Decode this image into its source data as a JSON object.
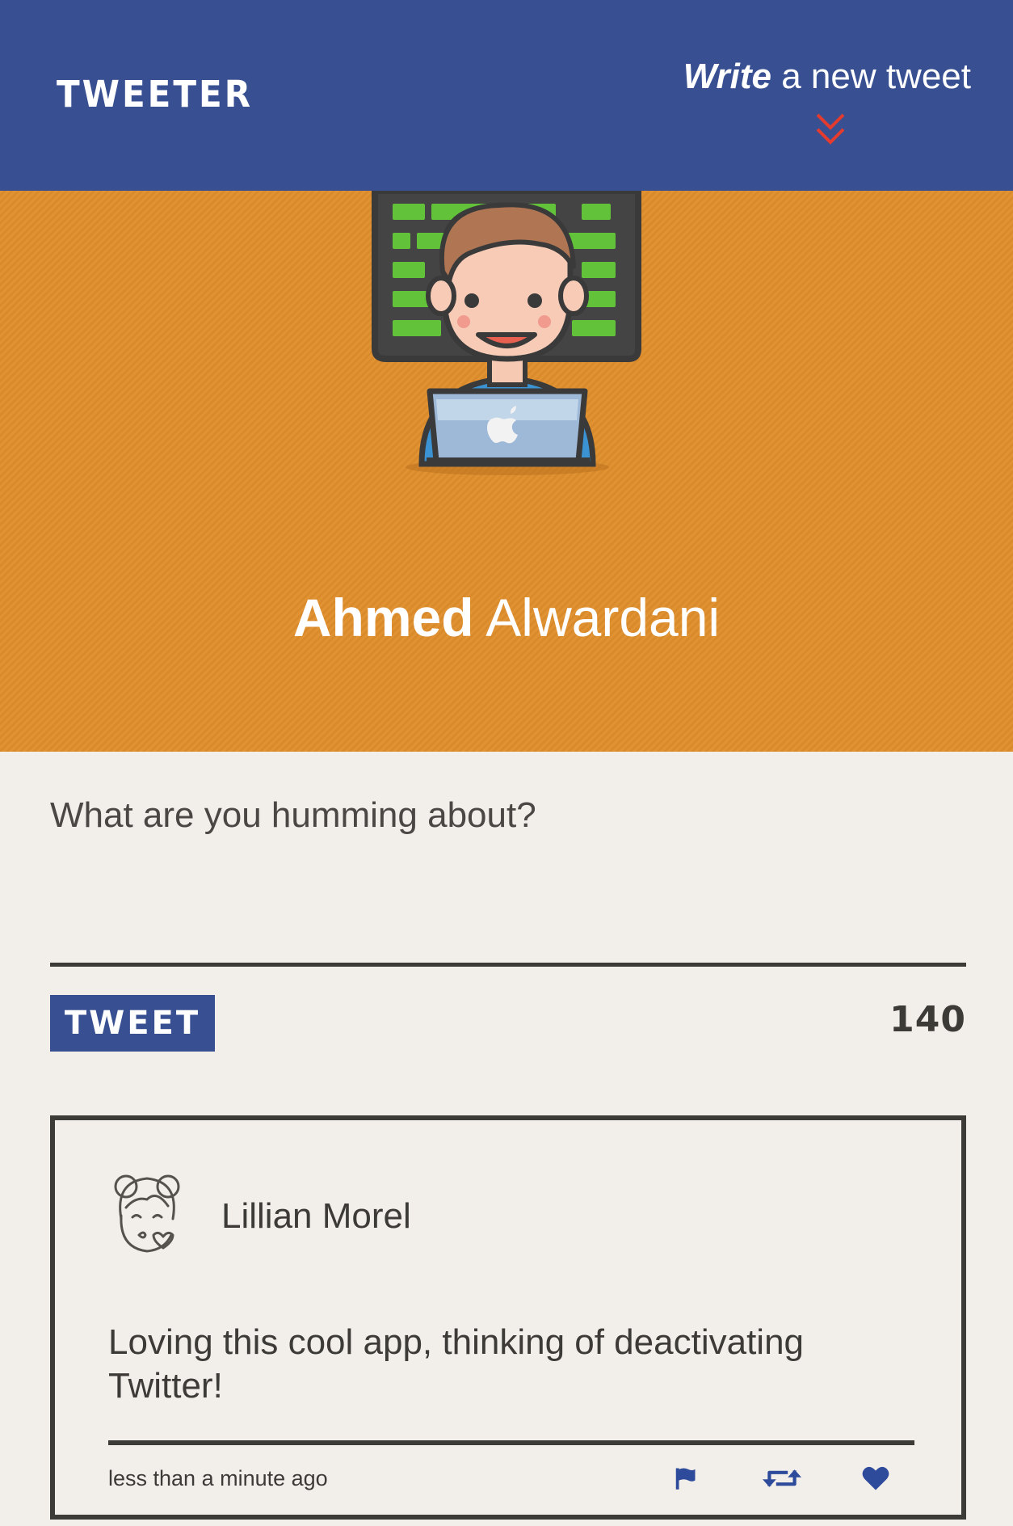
{
  "header": {
    "brand": "TWEETER",
    "compose_toggle": {
      "strong": "Write",
      "rest": " a new tweet"
    }
  },
  "profile": {
    "first_name": "Ahmed",
    "last_name": "Alwardani"
  },
  "composer": {
    "placeholder": "What are you humming about?",
    "value": "",
    "button_label": "TWEET",
    "char_count": "140"
  },
  "tweets": [
    {
      "author": "Lillian Morel",
      "text": "Loving this cool app, thinking of deactivating Twitter!",
      "timestamp": "less than a minute ago",
      "actions": [
        "flag-icon",
        "retweet-icon",
        "heart-icon"
      ]
    }
  ],
  "colors": {
    "nav": "#385092",
    "hero": "#e08e2b",
    "background": "#f2efeb",
    "text": "#3d3b38",
    "chevron": "#e33b2e",
    "action_icon": "#2e4a9a"
  }
}
